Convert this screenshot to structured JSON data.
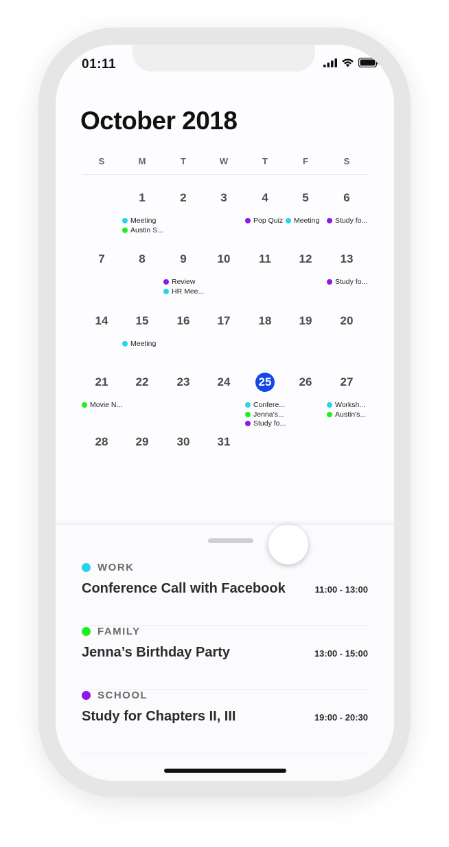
{
  "status": {
    "time": "01:11"
  },
  "calendar": {
    "month_title": "October 2018",
    "weekdays": [
      "S",
      "M",
      "T",
      "W",
      "T",
      "F",
      "S"
    ],
    "today": 25,
    "weeks": [
      [
        null,
        1,
        2,
        3,
        4,
        5,
        6
      ],
      [
        7,
        8,
        9,
        10,
        11,
        12,
        13
      ],
      [
        14,
        15,
        16,
        17,
        18,
        19,
        20
      ],
      [
        21,
        22,
        23,
        24,
        25,
        26,
        27
      ],
      [
        28,
        29,
        30,
        31,
        null,
        null,
        null
      ]
    ],
    "events": [
      {
        "day": 1,
        "label": "Meeting",
        "category": "work"
      },
      {
        "day": 1,
        "label": "Austin S...",
        "category": "family"
      },
      {
        "day": 4,
        "label": "Pop Quiz",
        "category": "school"
      },
      {
        "day": 5,
        "label": "Meeting",
        "category": "work"
      },
      {
        "day": 6,
        "label": "Study fo...",
        "category": "school"
      },
      {
        "day": 9,
        "label": "Review",
        "category": "school"
      },
      {
        "day": 9,
        "label": "HR Mee...",
        "category": "work"
      },
      {
        "day": 13,
        "label": "Study fo...",
        "category": "school"
      },
      {
        "day": 15,
        "label": "Meeting",
        "category": "work"
      },
      {
        "day": 21,
        "label": "Movie N...",
        "category": "family"
      },
      {
        "day": 25,
        "label": "Confere...",
        "category": "work"
      },
      {
        "day": 25,
        "label": "Jenna's...",
        "category": "family"
      },
      {
        "day": 25,
        "label": "Study fo...",
        "category": "school"
      },
      {
        "day": 27,
        "label": "Worksh...",
        "category": "work"
      },
      {
        "day": 27,
        "label": "Austin's...",
        "category": "family"
      }
    ]
  },
  "colors": {
    "work": "#27d3ee",
    "family": "#1ff01b",
    "school": "#8d19e6",
    "today": "#1446e8"
  },
  "agenda": [
    {
      "category": "WORK",
      "color_key": "work",
      "title": "Conference Call with Facebook",
      "time": "11:00 - 13:00"
    },
    {
      "category": "FAMILY",
      "color_key": "family",
      "title": "Jenna’s Birthday Party",
      "time": "13:00 - 15:00"
    },
    {
      "category": "SCHOOL",
      "color_key": "school",
      "title": "Study for Chapters II, III",
      "time": "19:00 - 20:30"
    }
  ],
  "icons": [
    "signal-icon",
    "wifi-icon",
    "battery-icon"
  ]
}
